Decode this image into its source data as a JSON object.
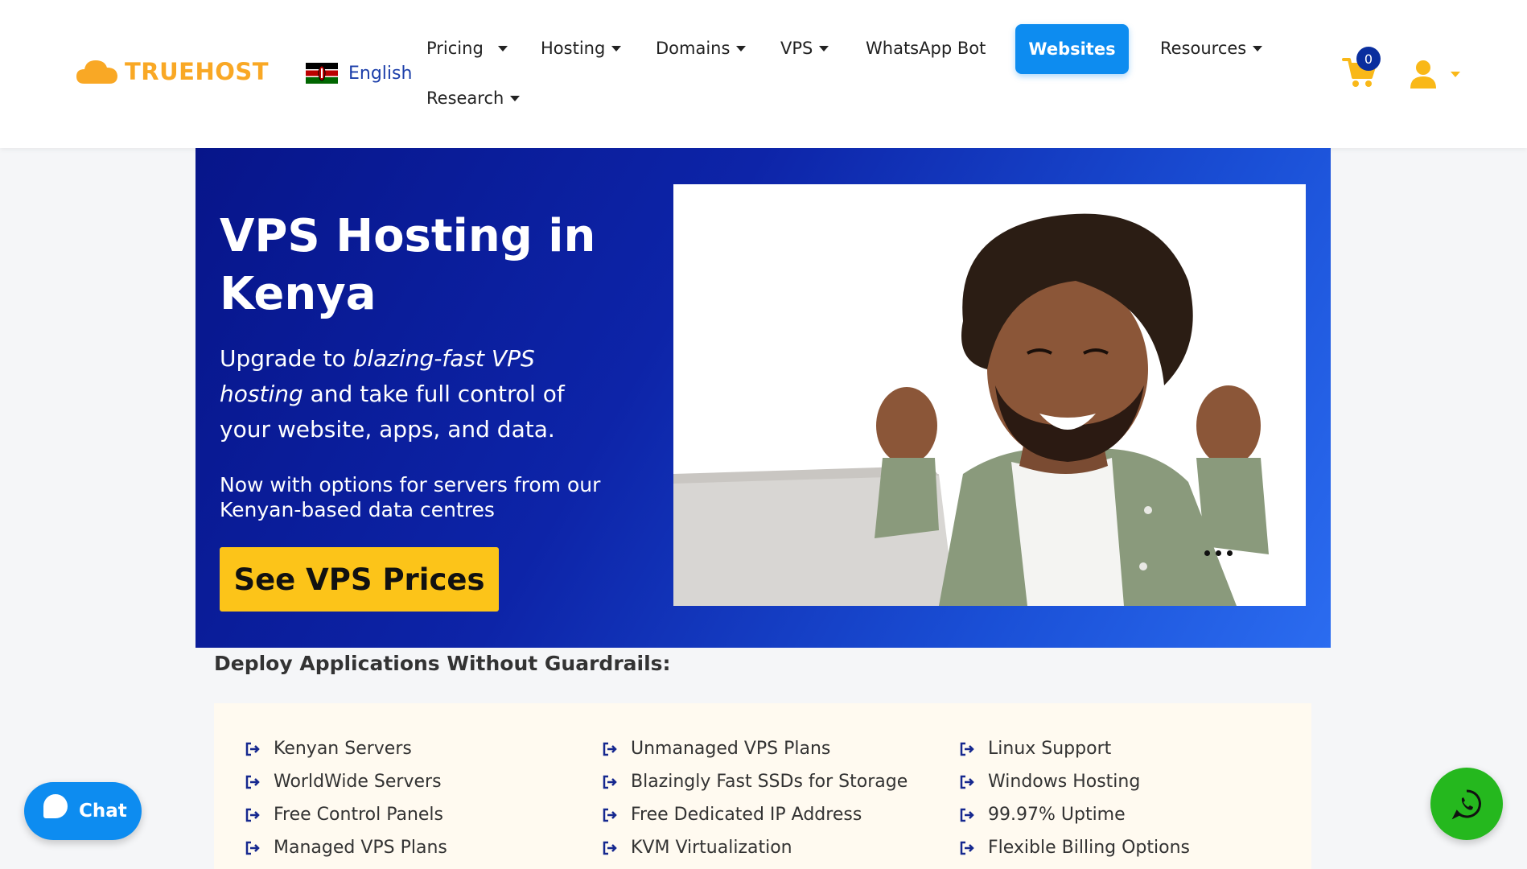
{
  "brand": {
    "name": "TRUEHOST",
    "color": "#f9a825"
  },
  "language": {
    "label": "English",
    "flag": "kenya-flag-icon"
  },
  "nav": {
    "pricing": "Pricing",
    "hosting": "Hosting",
    "domains": "Domains",
    "vps": "VPS",
    "whatsapp_bot": "WhatsApp Bot",
    "websites": "Websites",
    "resources": "Resources",
    "research": "Research"
  },
  "cart": {
    "count": "0",
    "icon": "cart-icon"
  },
  "user": {
    "icon": "user-icon"
  },
  "hero": {
    "title": "VPS Hosting in Kenya",
    "sub_prefix": "Upgrade to ",
    "sub_em": "blazing-fast VPS hosting",
    "sub_suffix": " and take full control of your website, apps, and data.",
    "note": "Now with options for servers from our Kenyan-based data centres",
    "cta": "See VPS Prices",
    "gradient_start": "#07158a",
    "gradient_end": "#2b6cf0",
    "cta_color": "#fcc419"
  },
  "features": {
    "title": "Deploy Applications Without Guardrails:",
    "columns": [
      [
        "Kenyan Servers",
        "WorldWide Servers",
        "Free Control Panels",
        "Managed VPS Plans"
      ],
      [
        "Unmanaged VPS Plans",
        "Blazingly Fast SSDs for Storage",
        "Free Dedicated IP Address",
        "KVM Virtualization"
      ],
      [
        "Linux Support",
        "Windows Hosting",
        "99.97% Uptime",
        "Flexible Billing Options"
      ]
    ]
  },
  "chat": {
    "label": "Chat",
    "color": "#0d8cf0"
  },
  "whatsapp": {
    "icon": "whatsapp-icon",
    "color": "#25b81e"
  }
}
